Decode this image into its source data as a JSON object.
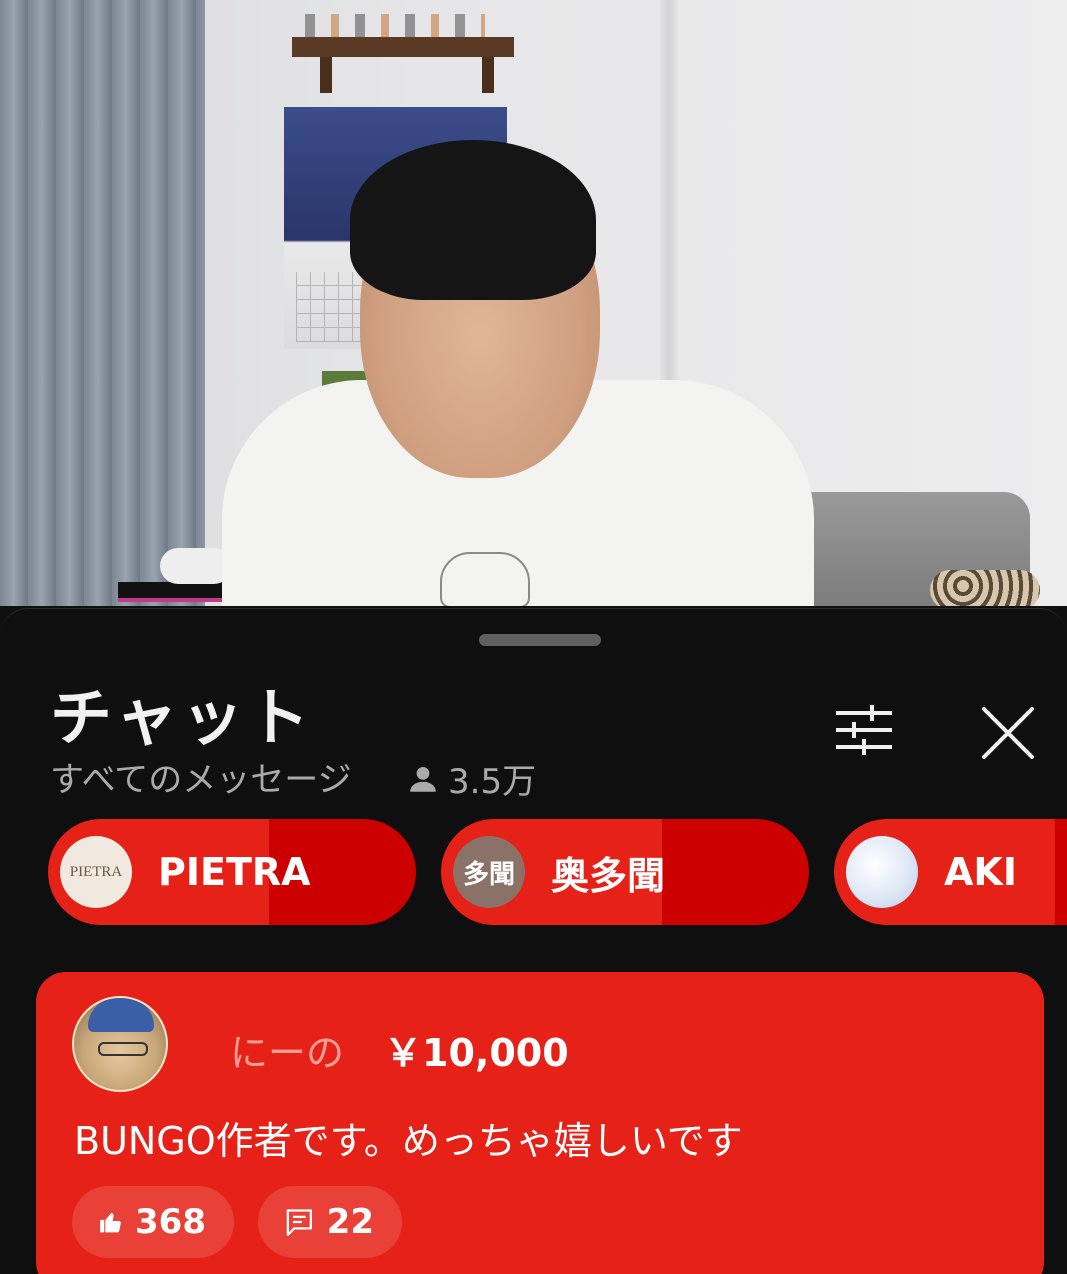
{
  "chat": {
    "title": "チャット",
    "filter_label": "すべてのメッセージ",
    "viewer_count": "3.5万"
  },
  "tickers": [
    {
      "name": "PIETRA",
      "avatar_text": "PIETRA",
      "avatar_color": "#f1e8df"
    },
    {
      "name": "奥多聞",
      "avatar_text": "多聞",
      "avatar_color": "#8a7268"
    },
    {
      "name": "AKI",
      "avatar_text": "",
      "avatar_color": "#dfe8f6"
    }
  ],
  "superchat": {
    "author": "にーの",
    "amount": "￥10,000",
    "message": "BUNGO作者です。めっちゃ嬉しいです",
    "likes": "368",
    "replies": "22"
  },
  "colors": {
    "superchat_red": "#e62117",
    "ticker_dark_red": "#cc0000",
    "panel_bg": "#0f0f0f",
    "muted_text": "#aaaaaa"
  }
}
